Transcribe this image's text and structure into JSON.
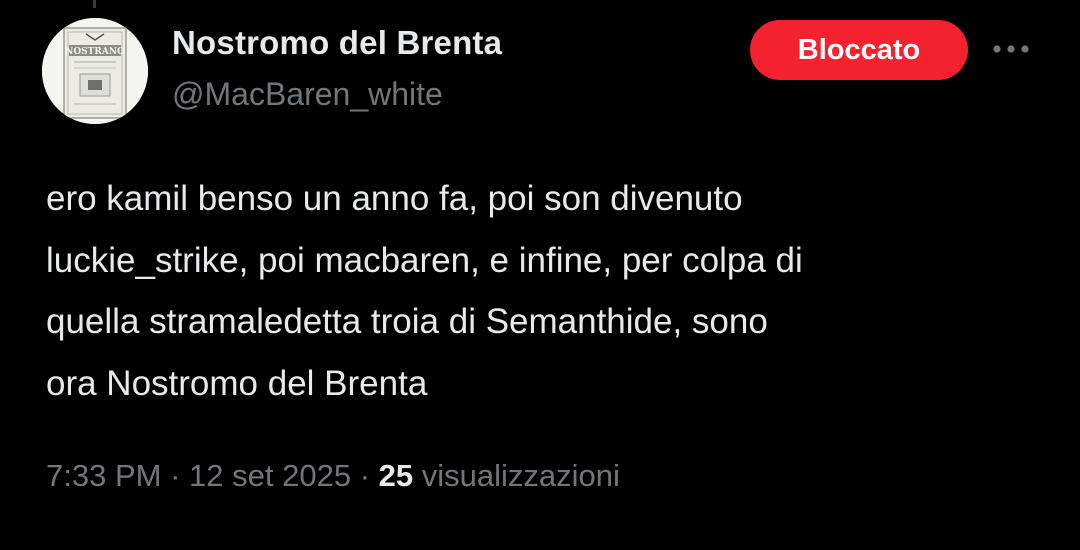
{
  "author": {
    "display_name": "Nostromo del Brenta",
    "handle": "@MacBaren_white",
    "avatar_label": "NOSTRANO"
  },
  "actions": {
    "blocked_label": "Bloccato",
    "more_icon": "ellipsis-icon"
  },
  "tweet": {
    "lines": [
      "ero kamil benso un anno fa, poi son divenuto",
      "luckie_strike, poi macbaren, e infine, per colpa di",
      "quella stramaledetta troia di Semanthide, sono",
      "ora Nostromo del Brenta"
    ]
  },
  "meta": {
    "time": "7:33 PM",
    "separator": "·",
    "date": "12 set 2025",
    "views_count": "25",
    "views_label": "visualizzazioni"
  },
  "colors": {
    "background": "#000000",
    "primary_text": "#e7e9ea",
    "secondary_text": "#71767b",
    "blocked_button": "#f4212e"
  }
}
